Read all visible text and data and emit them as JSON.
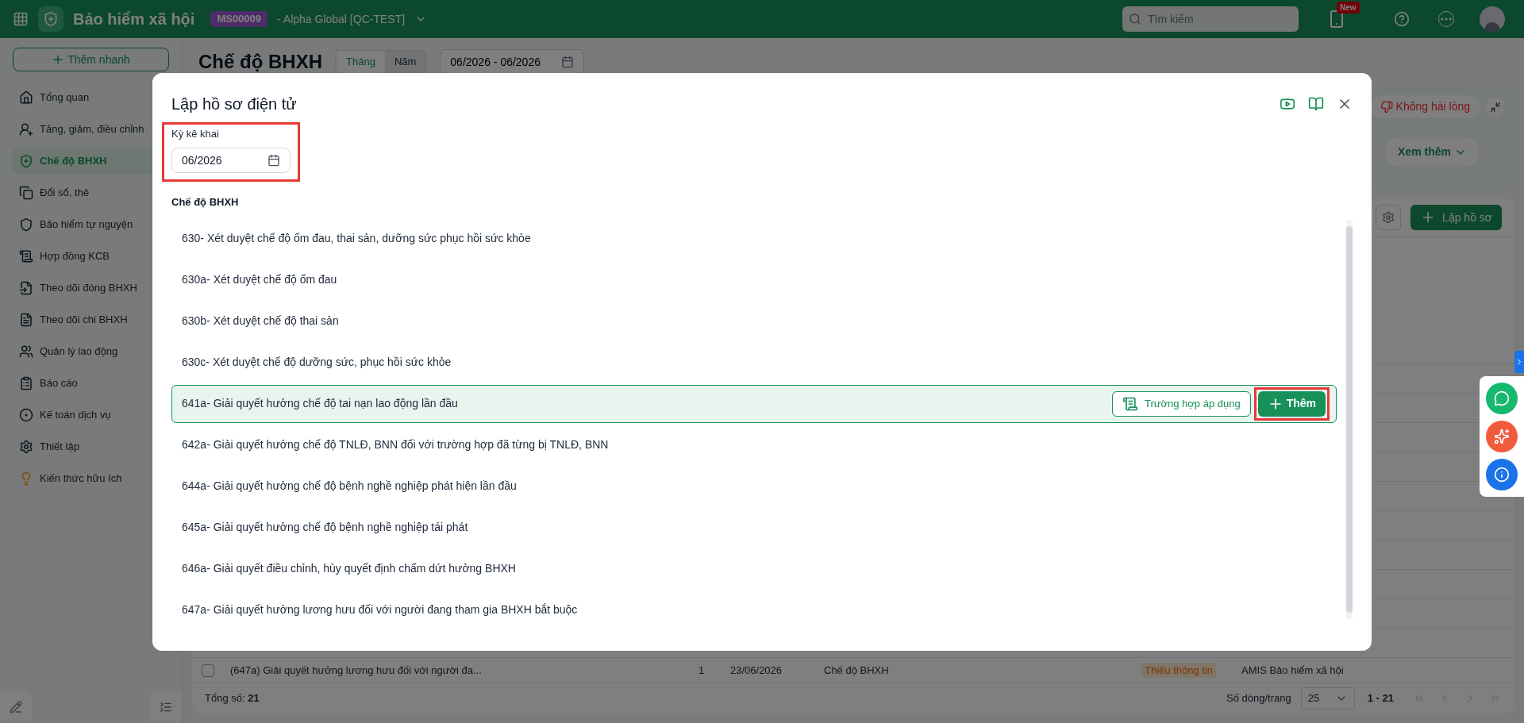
{
  "topbar": {
    "app_name": "Bảo hiểm xã hội",
    "company_code": "MS00009",
    "company_name": "- Alpha Global [QC-TEST]",
    "search": {
      "placeholder": "Tìm kiếm"
    },
    "new_badge": "New"
  },
  "sidebar": {
    "quick_add": "Thêm nhanh",
    "items": [
      {
        "label": "Tổng quan",
        "selected": false
      },
      {
        "label": "Tăng, giảm, điều chỉnh",
        "selected": false
      },
      {
        "label": "Chế độ BHXH",
        "selected": true
      },
      {
        "label": "Đổi sổ, thẻ",
        "selected": false
      },
      {
        "label": "Bảo hiểm tự nguyện",
        "selected": false
      },
      {
        "label": "Hợp đồng KCB",
        "selected": false
      },
      {
        "label": "Theo dõi đóng BHXH",
        "selected": false
      },
      {
        "label": "Theo dõi chi BHXH",
        "selected": false
      },
      {
        "label": "Quản lý lao động",
        "selected": false
      },
      {
        "label": "Báo cáo",
        "selected": false
      },
      {
        "label": "Kế toán dịch vụ",
        "selected": false
      },
      {
        "label": "Thiết lập",
        "selected": false
      },
      {
        "label": "Kiến thức hữu ích",
        "selected": false
      }
    ]
  },
  "page": {
    "title": "Chế độ BHXH",
    "period_tabs": [
      {
        "label": "Tháng",
        "selected": true
      },
      {
        "label": "Năm",
        "selected": false
      }
    ],
    "date_range": "06/2026 - 06/2026",
    "feedback": {
      "dislike": "Không hài lòng",
      "more": "Xem thêm"
    },
    "create_button": "Lập hồ sơ",
    "table": {
      "rows": [
        {
          "checked": false,
          "cells": [
            "(647a) Giải quyết hưởng lương hưu đối với người đa...",
            "1",
            "23/06/2026",
            "Chế độ BHXH",
            "Thiếu thông tin",
            "AMIS Bảo hiểm xã hội"
          ]
        }
      ]
    },
    "footer": {
      "total": "Tổng số: **21**",
      "rows_per_page_label": "Số dòng/trang",
      "rows_per_page": "25",
      "range": "1 - 21"
    }
  },
  "modal": {
    "title": "Lập hồ sơ điện tử",
    "period": {
      "label": "Kỳ kê khai",
      "value": "06/2026",
      "highlighted": true
    },
    "section_title": "Chế độ BHXH",
    "case_button": "Trường hợp áp dụng",
    "add_button": "Thêm",
    "add_highlighted": true,
    "items": [
      {
        "text": "630- Xét duyệt chế độ ốm đau, thai sản, dưỡng sức phục hồi sức khỏe",
        "selected": false
      },
      {
        "text": "630a- Xét duyệt chế độ ốm đau",
        "selected": false
      },
      {
        "text": "630b- Xét duyệt chế độ thai sản",
        "selected": false
      },
      {
        "text": "630c- Xét duyệt chế độ dưỡng sức, phục hồi sức khỏe",
        "selected": false
      },
      {
        "text": "641a- Giải quyết hưởng chế độ tai nạn lao động lần đầu",
        "selected": true
      },
      {
        "text": "642a- Giải quyết hưởng chế độ TNLĐ, BNN đối với trường hợp đã từng bị TNLĐ, BNN",
        "selected": false
      },
      {
        "text": "644a- Giải quyết hưởng chế độ bệnh nghề nghiệp phát hiện lần đầu",
        "selected": false
      },
      {
        "text": "645a- Giải quyết hưởng chế độ bệnh nghề nghiệp tái phát",
        "selected": false
      },
      {
        "text": "646a- Giải quyết điều chỉnh, hủy quyết định chấm dứt hưởng BHXH",
        "selected": false
      },
      {
        "text": "647a- Giải quyết hưởng lương hưu đối với người đang tham gia BHXH bắt buộc",
        "selected": false
      }
    ]
  }
}
